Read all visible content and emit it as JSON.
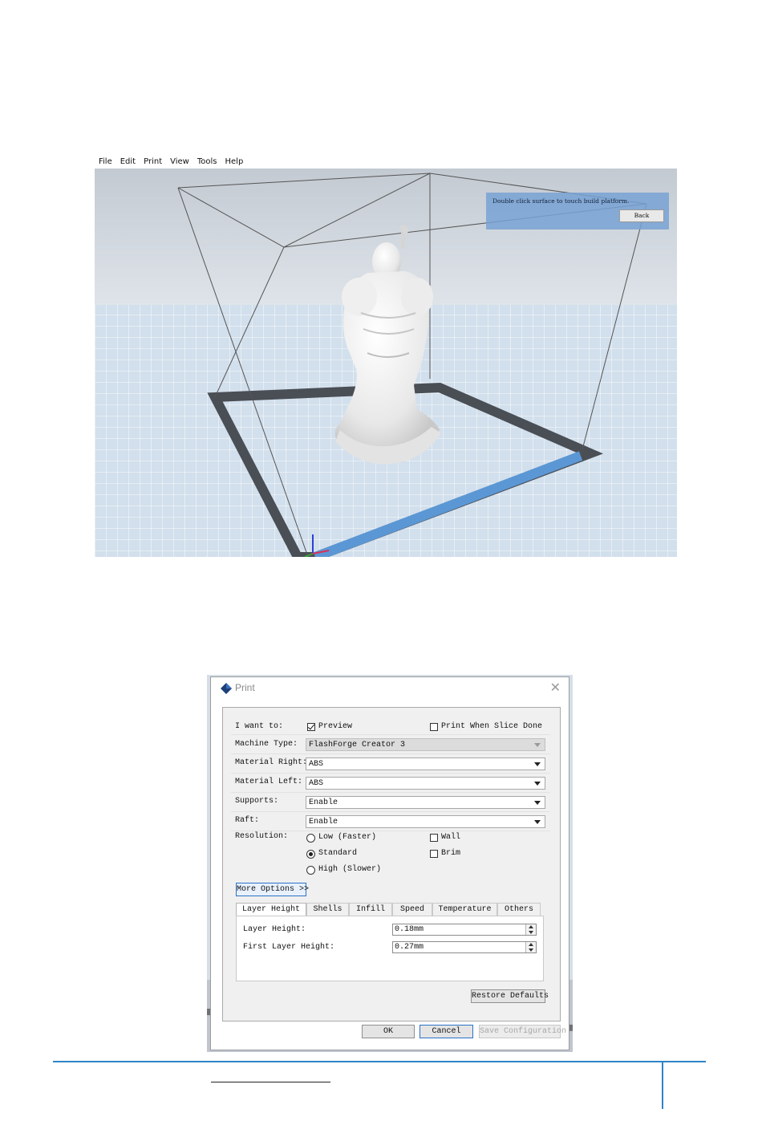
{
  "app": {
    "menu": [
      "File",
      "Edit",
      "Print",
      "View",
      "Tools",
      "Help"
    ],
    "notice": {
      "message": "Double click surface to touch build platform.",
      "back_label": "Back"
    }
  },
  "print_dialog": {
    "title": "Print",
    "i_want_to_label": "I want to:",
    "preview_label": "Preview",
    "preview_checked": true,
    "print_when_done_label": "Print When Slice Done",
    "print_when_done_checked": false,
    "machine_type_label": "Machine Type:",
    "machine_type_value": "FlashForge Creator 3",
    "material_right_label": "Material Right:",
    "material_right_value": "ABS",
    "material_left_label": "Material Left:",
    "material_left_value": "ABS",
    "supports_label": "Supports:",
    "supports_value": "Enable",
    "raft_label": "Raft:",
    "raft_value": "Enable",
    "resolution_label": "Resolution:",
    "resolution_options": [
      "Low (Faster)",
      "Standard",
      "High (Slower)"
    ],
    "resolution_selected": "Standard",
    "wall_label": "Wall",
    "brim_label": "Brim",
    "more_options_label": "More Options >>",
    "tabs": [
      "Layer Height",
      "Shells",
      "Infill",
      "Speed",
      "Temperature",
      "Others"
    ],
    "active_tab": "Layer Height",
    "layer_height_label": "Layer Height:",
    "layer_height_value": "0.18mm",
    "first_layer_height_label": "First Layer Height:",
    "first_layer_height_value": "0.27mm",
    "restore_defaults_label": "Restore Defaults",
    "ok_label": "OK",
    "cancel_label": "Cancel",
    "save_config_label": "Save Configuration"
  },
  "colors": {
    "accent": "#2e84c6",
    "build_plate": "#cfe0ef",
    "notice_panel": "#78a2d4",
    "model": "#f2f2f2"
  }
}
